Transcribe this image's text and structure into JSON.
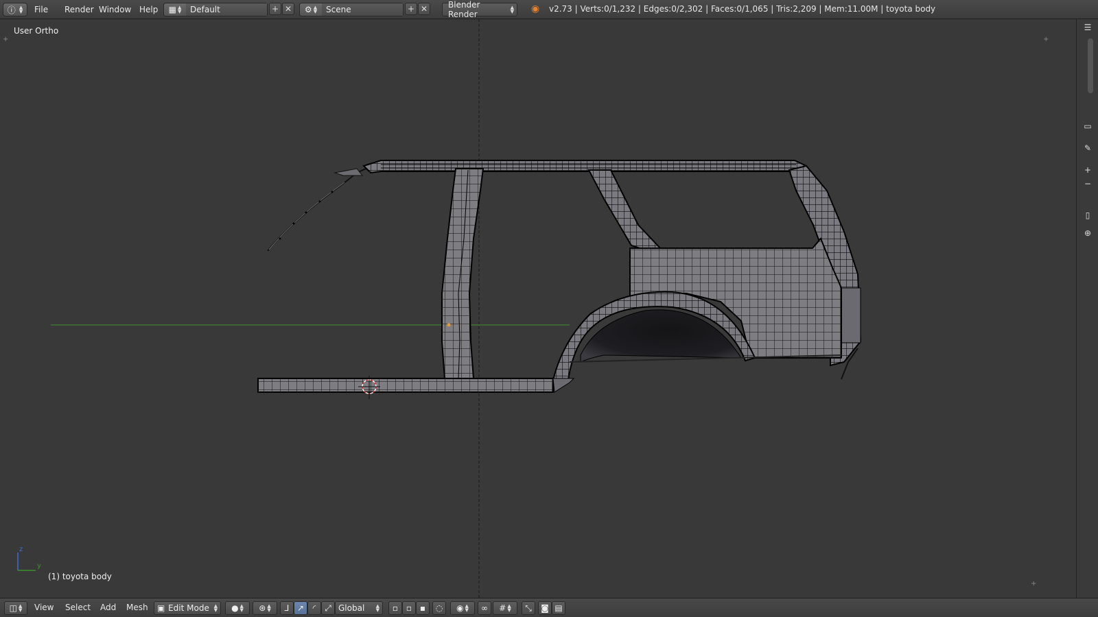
{
  "topbar": {
    "menus": [
      "File",
      "Render",
      "Window",
      "Help"
    ],
    "screen_layout": "Default",
    "scene": "Scene",
    "render_engine": "Blender Render",
    "stats": "v2.73 | Verts:0/1,232 | Edges:0/2,302 | Faces:0/1,065 | Tris:2,209 | Mem:11.00M | toyota body"
  },
  "viewport": {
    "view_name": "User Ortho",
    "object_label": "(1) toyota body",
    "axis_z": "z",
    "axis_y": "y"
  },
  "bottombar": {
    "menus": [
      "View",
      "Select",
      "Add",
      "Mesh"
    ],
    "mode": "Edit Mode",
    "orientation": "Global"
  },
  "colors": {
    "header_bg": "#444444",
    "viewport_bg": "#393939",
    "mesh_face": "#7b7b7f",
    "wire": "#000000",
    "axis_y": "#3f8f2f",
    "axis_z": "#3c6fd6",
    "cursor_red": "#d22828",
    "active_button": "#5a7298"
  }
}
